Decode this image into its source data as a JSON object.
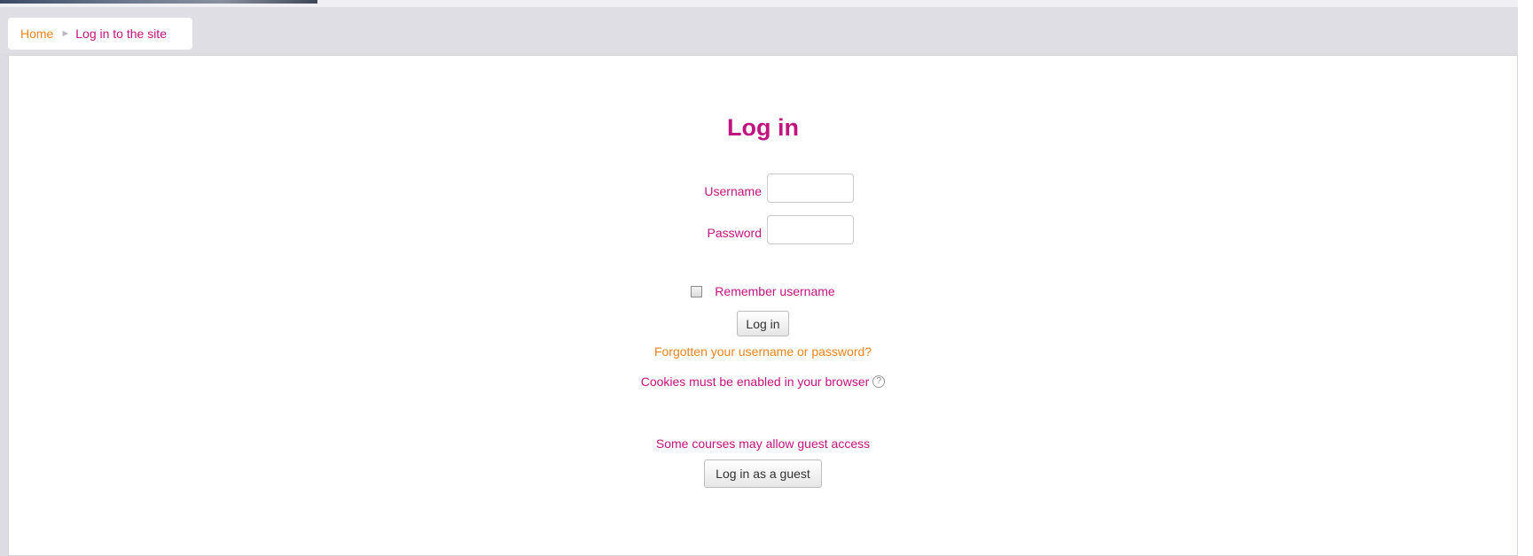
{
  "breadcrumb": {
    "home": "Home",
    "separator": "►",
    "current": "Log in to the site"
  },
  "login": {
    "heading": "Log in",
    "username_label": "Username",
    "username_value": "",
    "password_label": "Password",
    "password_value": "",
    "remember_label": "Remember username",
    "remember_checked": false,
    "submit_label": "Log in",
    "forgot_link": "Forgotten your username or password?",
    "cookies_text": "Cookies must be enabled in your browser",
    "help_icon_glyph": "?"
  },
  "guest": {
    "text": "Some courses may allow guest access",
    "button_label": "Log in as a guest"
  },
  "colors": {
    "brand_magenta": "#c0147e",
    "link_orange": "#e8841f"
  },
  "icons": {
    "separator": "breadcrumb-separator-icon",
    "help": "help-icon"
  }
}
